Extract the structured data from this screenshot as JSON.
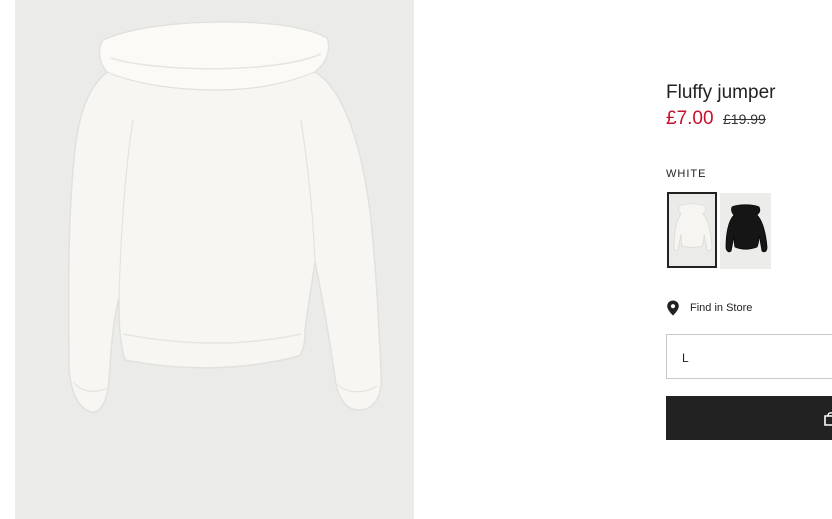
{
  "product": {
    "title": "Fluffy jumper",
    "price_sale": "£7.00",
    "price_original": "£19.99",
    "color_label": "WHITE",
    "swatches": [
      "white",
      "black"
    ],
    "selected_swatch": "white",
    "find_in_store": "Find in Store",
    "size_selected": "L"
  },
  "colors": {
    "sale_price": "#c8102e",
    "button": "#222222",
    "image_bg": "#ebebe9"
  }
}
